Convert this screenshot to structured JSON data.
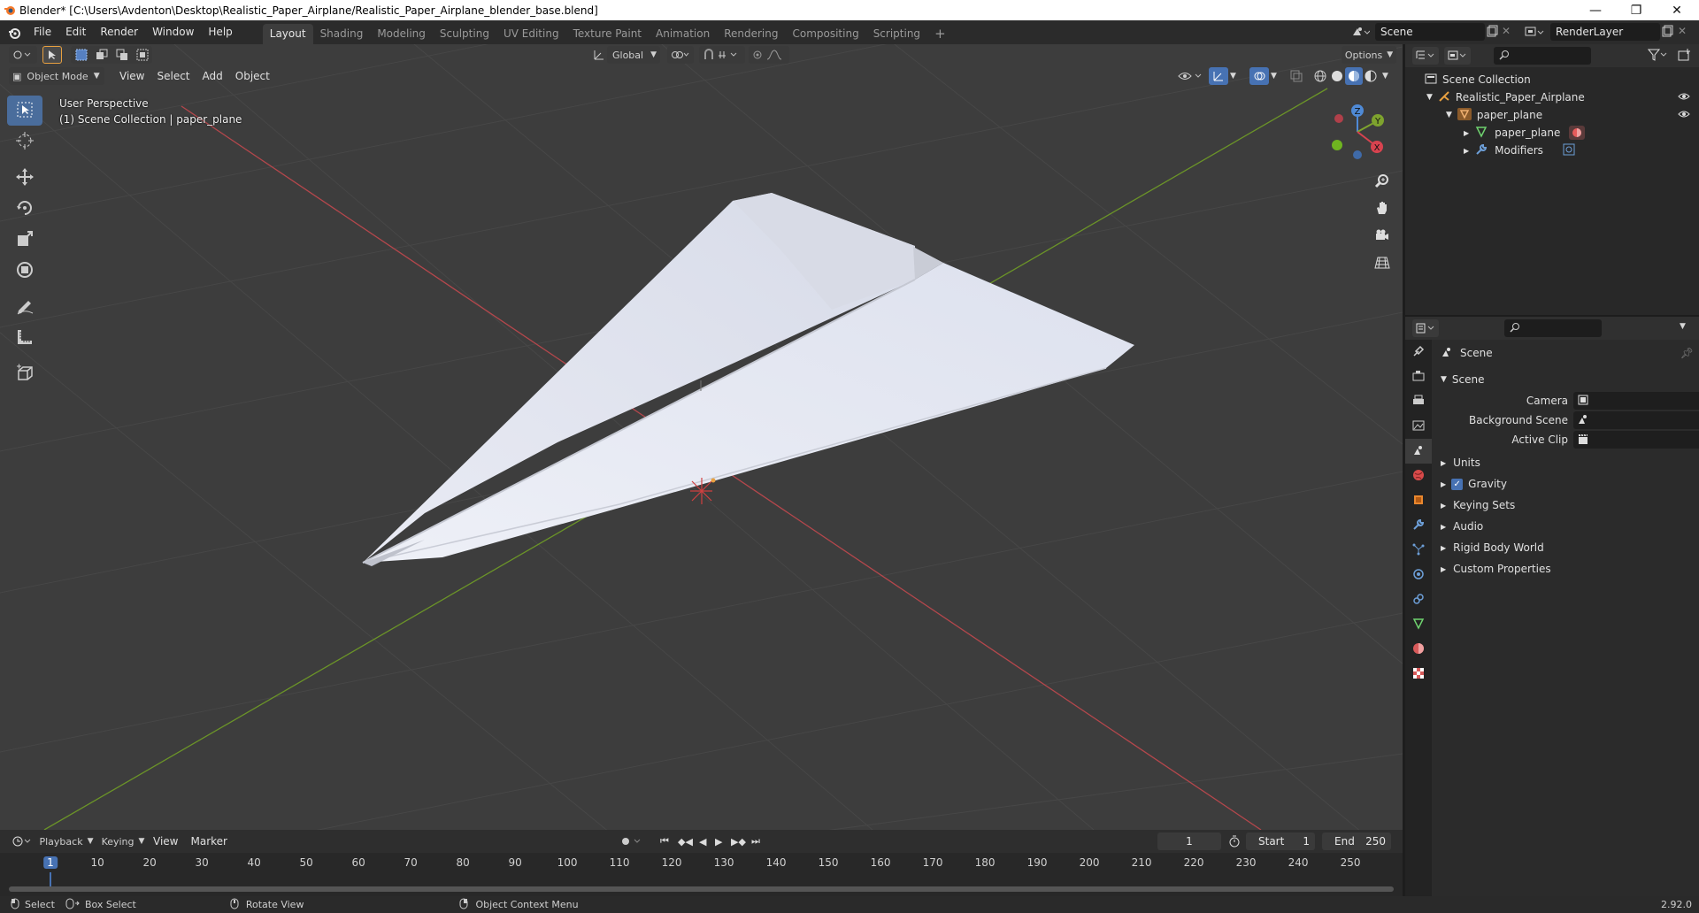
{
  "window": {
    "title": "Blender* [C:\\Users\\Avdenton\\Desktop\\Realistic_Paper_Airplane/Realistic_Paper_Airplane_blender_base.blend]",
    "minimize": "—",
    "maximize": "❐",
    "close": "✕"
  },
  "menu": {
    "file": "File",
    "edit": "Edit",
    "render": "Render",
    "window": "Window",
    "help": "Help"
  },
  "workspaces": [
    "Layout",
    "Shading",
    "Modeling",
    "Sculpting",
    "UV Editing",
    "Texture Paint",
    "Animation",
    "Rendering",
    "Compositing",
    "Scripting"
  ],
  "workspace_add": "+",
  "scene_selector": {
    "value": "Scene"
  },
  "renderlayer_selector": {
    "value": "RenderLayer"
  },
  "viewport": {
    "transform_orientation": "Global",
    "options_label": "Options",
    "mode": "Object Mode",
    "menus": [
      "View",
      "Select",
      "Add",
      "Object"
    ],
    "perspective_label": "User Perspective",
    "collection_label": "(1) Scene Collection | paper_plane",
    "gizmo": {
      "x": "X",
      "y": "Y",
      "z": "Z"
    }
  },
  "outliner": {
    "items": [
      {
        "label": "Scene Collection"
      },
      {
        "label": "Realistic_Paper_Airplane"
      },
      {
        "label": "paper_plane"
      },
      {
        "label": "paper_plane"
      },
      {
        "label": "Modifiers"
      }
    ]
  },
  "properties": {
    "header_title": "Scene",
    "section_title": "Scene",
    "camera_label": "Camera",
    "background_scene_label": "Background Scene",
    "active_clip_label": "Active Clip",
    "panels": [
      "Units",
      "Gravity",
      "Keying Sets",
      "Audio",
      "Rigid Body World",
      "Custom Properties"
    ],
    "gravity_checked": true
  },
  "timeline": {
    "menus": [
      "Playback",
      "Keying",
      "View",
      "Marker"
    ],
    "current_frame": "1",
    "start_label": "Start",
    "start_value": "1",
    "end_label": "End",
    "end_value": "250",
    "ruler_ticks": [
      "1",
      "10",
      "20",
      "30",
      "40",
      "50",
      "60",
      "70",
      "80",
      "90",
      "100",
      "110",
      "120",
      "130",
      "140",
      "150",
      "160",
      "170",
      "180",
      "190",
      "200",
      "210",
      "220",
      "230",
      "240",
      "250"
    ]
  },
  "statusbar": {
    "select": "Select",
    "box_select": "Box Select",
    "rotate_view": "Rotate View",
    "context_menu": "Object Context Menu",
    "version": "2.92.0"
  },
  "colors": {
    "accent": "#4772b3",
    "x_axis": "#c1464c",
    "y_axis": "#6f9a2b",
    "viewport_bg": "#3d3d3d"
  }
}
